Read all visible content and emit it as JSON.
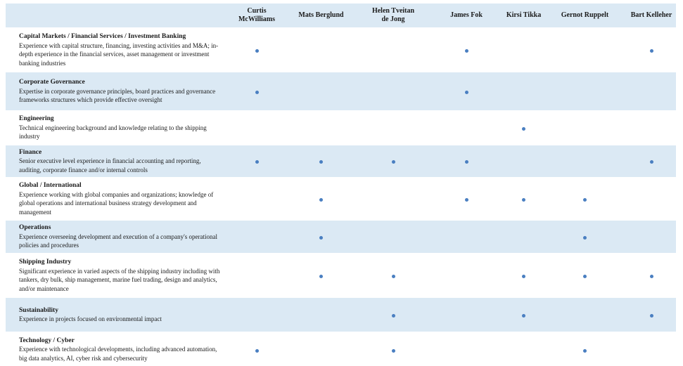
{
  "colors": {
    "row_shade": "#dbe9f4",
    "dot": "#4a7fc1"
  },
  "directors": [
    "Curtis McWilliams",
    "Mats Berglund",
    "Helen Tveitan\nde Jong",
    "James Fok",
    "Kirsi Tikka",
    "Gernot Ruppelt",
    "Bart Kelleher"
  ],
  "skills": [
    {
      "title": "Capital Markets / Financial Services / Investment Banking",
      "description": "Experience with capital structure, financing, investing activities and M&A; in-depth experience in the financial services, asset management or investment banking industries",
      "marks": [
        true,
        false,
        false,
        true,
        false,
        false,
        true
      ]
    },
    {
      "title": "Corporate Governance",
      "description": "Expertise in corporate governance principles, board practices and governance frameworks structures which provide effective oversight",
      "marks": [
        true,
        false,
        false,
        true,
        false,
        false,
        false
      ]
    },
    {
      "title": "Engineering",
      "description": "Technical engineering background and knowledge relating to the shipping industry",
      "marks": [
        false,
        false,
        false,
        false,
        true,
        false,
        false
      ]
    },
    {
      "title": "Finance",
      "description": "Senior executive level experience in financial accounting and reporting, auditing, corporate finance and/or internal controls",
      "marks": [
        true,
        true,
        true,
        true,
        false,
        false,
        true
      ]
    },
    {
      "title": "Global / International",
      "description": "Experience working with global companies and organizations; knowledge of global operations and international business strategy development and management",
      "marks": [
        false,
        true,
        false,
        true,
        true,
        true,
        false
      ]
    },
    {
      "title": "Operations",
      "description": "Experience overseeing development and execution of a company's operational policies and procedures",
      "marks": [
        false,
        true,
        false,
        false,
        false,
        true,
        false
      ]
    },
    {
      "title": "Shipping Industry",
      "description": "Significant experience in varied aspects of the shipping industry including with tankers, dry bulk, ship management, marine fuel trading, design and analytics, and/or maintenance",
      "marks": [
        false,
        true,
        true,
        false,
        true,
        true,
        true
      ]
    },
    {
      "title": "Sustainability",
      "description": "Experience in projects focused on  environmental impact",
      "marks": [
        false,
        false,
        true,
        false,
        true,
        false,
        true
      ]
    },
    {
      "title": "Technology / Cyber",
      "description": "Experience with technological developments, including advanced automation, big data analytics, AI, cyber risk and cybersecurity",
      "marks": [
        true,
        false,
        true,
        false,
        false,
        true,
        false
      ]
    }
  ]
}
